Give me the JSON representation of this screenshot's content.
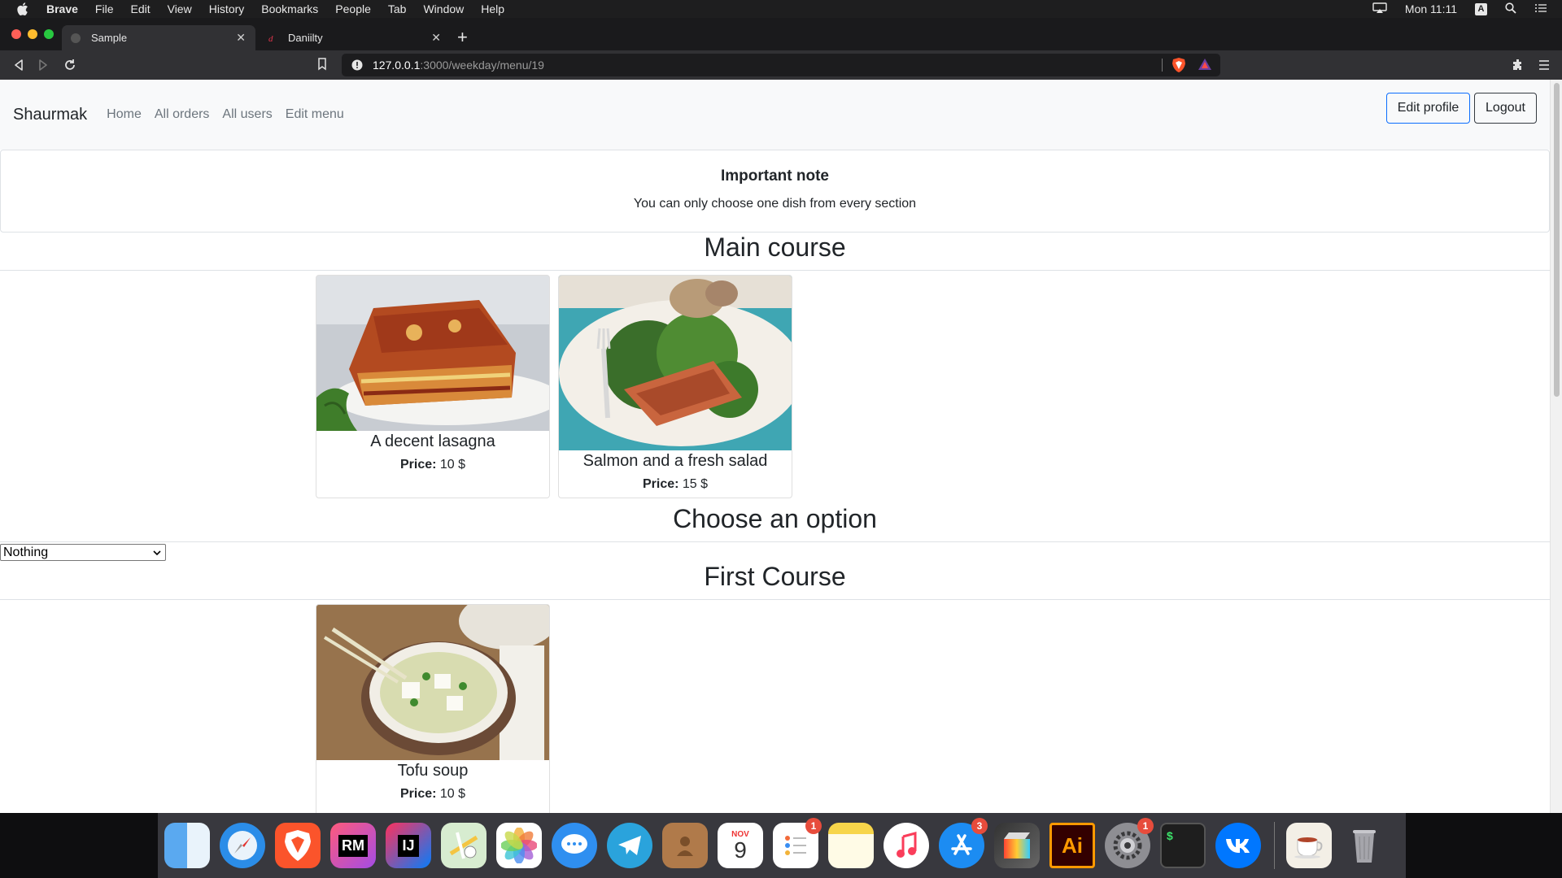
{
  "menubar": {
    "app": "Brave",
    "items": [
      "File",
      "Edit",
      "View",
      "History",
      "Bookmarks",
      "People",
      "Tab",
      "Window",
      "Help"
    ],
    "clock": "Mon 11:11",
    "input_source": "A"
  },
  "tabs": [
    {
      "title": "Sample",
      "active": true
    },
    {
      "title": "Daniilty",
      "active": false
    }
  ],
  "address": {
    "host": "127.0.0.1",
    "path": ":3000/weekday/menu/19"
  },
  "navbar": {
    "brand": "Shaurmak",
    "links": [
      "Home",
      "All orders",
      "All users",
      "Edit menu"
    ],
    "edit_profile": "Edit profile",
    "logout": "Logout"
  },
  "note": {
    "title": "Important note",
    "text": "You can only choose one dish from every section"
  },
  "sections": [
    {
      "title": "Main course",
      "dishes": [
        {
          "name": "A decent lasagna",
          "price_label": "Price:",
          "price": "10 $"
        },
        {
          "name": "Salmon and a fresh salad",
          "price_label": "Price:",
          "price": "15 $"
        }
      ]
    },
    {
      "title": "First Course",
      "dishes": [
        {
          "name": "Tofu soup",
          "price_label": "Price:",
          "price": "10 $"
        }
      ]
    }
  ],
  "option": {
    "title": "Choose an option",
    "selected": "Nothing"
  },
  "dock": {
    "badges": {
      "reminders": "1",
      "appstore": "3",
      "preferences": "1"
    },
    "calendar_month": "NOV",
    "calendar_day": "9",
    "jetbrains_rm": "RM",
    "jetbrains_ij": "IJ",
    "illustrator": "Ai",
    "terminal": "$"
  }
}
